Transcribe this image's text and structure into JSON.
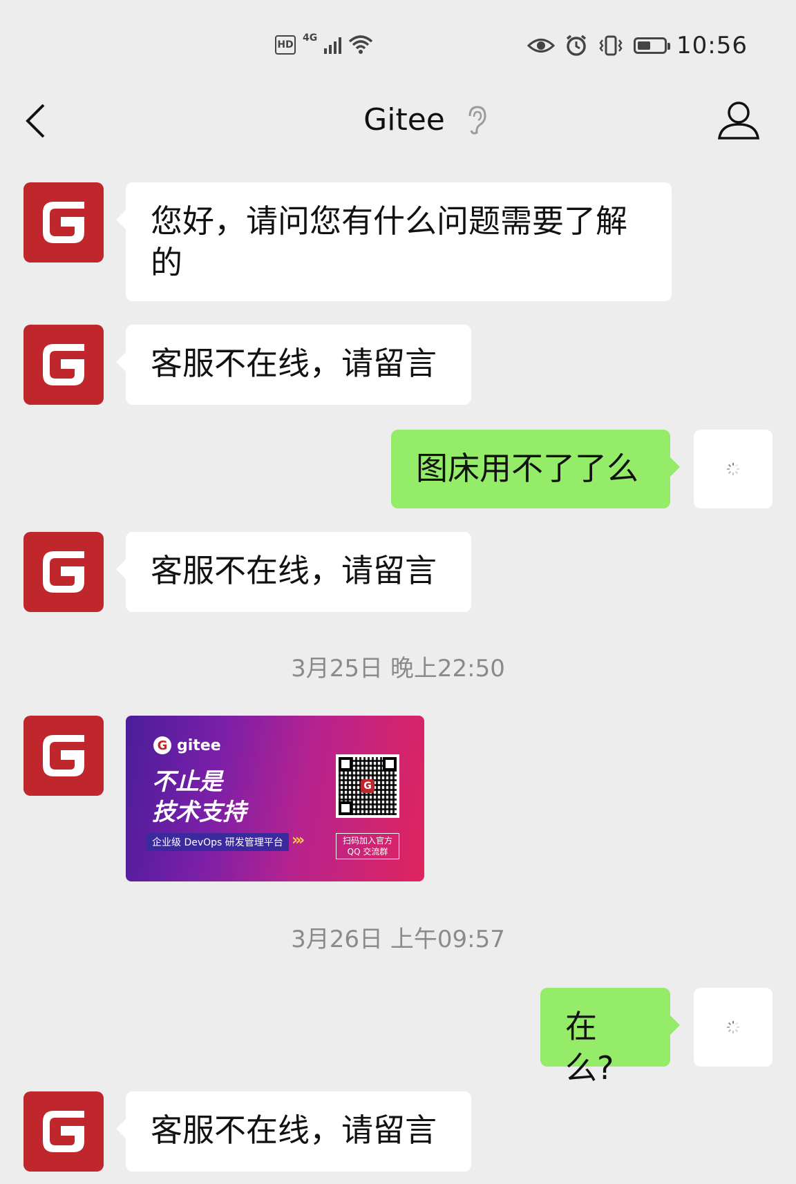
{
  "status_bar": {
    "hd": "HD",
    "network": "4G",
    "time": "10:56",
    "battery_level": 0.5,
    "icons": [
      "hd-icon",
      "signal-icon",
      "wifi-icon",
      "eye-icon",
      "alarm-icon",
      "vibrate-icon",
      "battery-icon"
    ]
  },
  "header": {
    "title": "Gitee",
    "icons": [
      "back-arrow-icon",
      "earpiece-icon",
      "profile-icon"
    ]
  },
  "messages": [
    {
      "from": "gitee",
      "text": "您好，请问您有什么问题需要了解的"
    },
    {
      "from": "gitee",
      "text": "客服不在线，请留言"
    },
    {
      "from": "me",
      "text": "图床用不了了么"
    },
    {
      "from": "gitee",
      "text": "客服不在线，请留言"
    },
    {
      "timestamp": "3月25日 晚上22:50"
    },
    {
      "from": "gitee",
      "image_card": {
        "brand": "gitee",
        "headline_1": "不止是",
        "headline_2": "技术支持",
        "tagline": "企业级 DevOps 研发管理平台",
        "qr_caption_1": "扫码加入官方",
        "qr_caption_2": "QQ 交流群"
      }
    },
    {
      "timestamp": "3月26日 上午09:57"
    },
    {
      "from": "me",
      "text": "在么?"
    },
    {
      "from": "gitee",
      "text": "客服不在线，请留言"
    }
  ],
  "avatar_letter": "G",
  "colors": {
    "background": "#ededed",
    "brand_red": "#c0272d",
    "outgoing_bubble": "#95ec69",
    "incoming_bubble": "#ffffff"
  }
}
